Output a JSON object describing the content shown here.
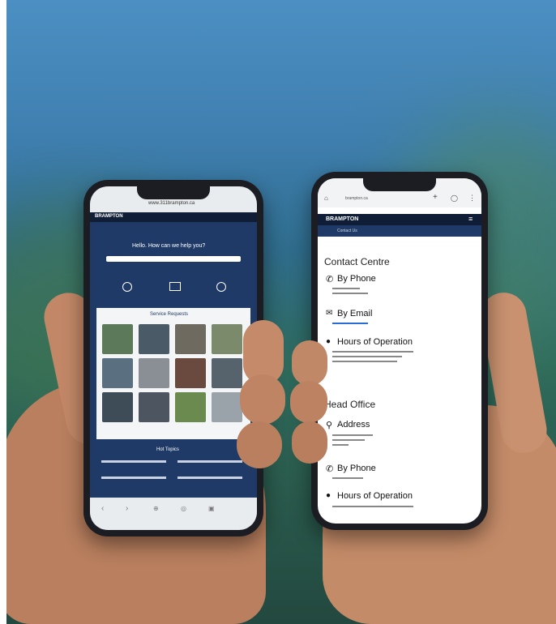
{
  "left_phone": {
    "url": "www.311brampton.ca",
    "brand": "BRAMPTON",
    "hero_title": "Hello. How can we help you?",
    "section_title": "Service Requests",
    "faq_title": "Hot Topics"
  },
  "right_phone": {
    "url": "brampton.ca",
    "brand": "BRAMPTON",
    "nav_label": "Contact Us",
    "contact_centre": {
      "heading": "Contact Centre",
      "by_phone": "By Phone",
      "by_email": "By Email",
      "hours": "Hours of Operation"
    },
    "head_office": {
      "heading": "Head Office",
      "address": "Address",
      "by_phone": "By Phone",
      "hours": "Hours of Operation"
    }
  },
  "colors": {
    "brand_navy": "#1f3a66",
    "link_blue": "#2a6bd6"
  }
}
